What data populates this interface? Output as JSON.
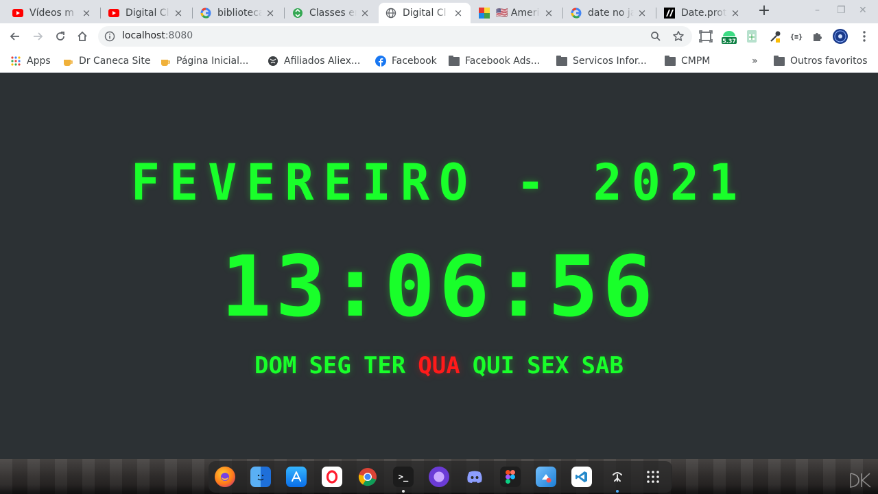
{
  "browser": {
    "tabs": [
      {
        "title": "Vídeos m",
        "favicon": "youtube-icon"
      },
      {
        "title": "Digital Cl",
        "favicon": "youtube-icon"
      },
      {
        "title": "biblioteca",
        "favicon": "google-icon"
      },
      {
        "title": "Classes er",
        "favicon": "recycle-icon"
      },
      {
        "title": "Digital Cl",
        "favicon": "globe-icon",
        "active": true
      },
      {
        "title": "🇺🇸 Americ",
        "favicon": "multicolor-icon"
      },
      {
        "title": "date no ja",
        "favicon": "google-icon"
      },
      {
        "title": "Date.prot",
        "favicon": "mdn-icon"
      }
    ],
    "new_tab": "+",
    "window_controls": {
      "minimize": "–",
      "maximize": "❐",
      "close": "✕"
    },
    "address": {
      "host": "localhost",
      "port": ":8080"
    },
    "extension_badge": "5.37",
    "bookmarks": [
      {
        "label": "Apps",
        "icon": "apps-grid-icon"
      },
      {
        "label": "Dr Caneca Site",
        "icon": "caneca-icon"
      },
      {
        "label": "Página Inicial...",
        "icon": "caneca-icon"
      },
      {
        "label": "Afiliados Aliex...",
        "icon": "globe-icon"
      },
      {
        "label": "Facebook",
        "icon": "facebook-icon"
      },
      {
        "label": "Facebook Ads...",
        "icon": "folder-icon"
      },
      {
        "label": "Servicos Infor...",
        "icon": "folder-icon"
      },
      {
        "label": "CMPM",
        "icon": "folder-icon"
      },
      {
        "label": "»",
        "icon": "overflow-chevron-icon"
      },
      {
        "label": "Outros favoritos",
        "icon": "folder-icon"
      }
    ]
  },
  "clock": {
    "month_year": "FEVEREIRO - 2021",
    "time": "13:06:56",
    "weekdays": [
      "DOM",
      "SEG",
      "TER",
      "QUA",
      "QUI",
      "SEX",
      "SAB"
    ],
    "current_weekday": "QUA",
    "colors": {
      "lcd_green": "#19ff2a",
      "highlight_red": "#ff1a1a",
      "background": "#2c3134"
    }
  },
  "dock": {
    "apps": [
      "firefox-icon",
      "finder-icon",
      "app-store-icon",
      "opera-icon",
      "chrome-icon",
      "terminal-icon",
      "browser-purple-icon",
      "discord-icon",
      "figma-icon",
      "screenshot-tool-icon",
      "vscode-icon",
      "launcher-icon",
      "app-grid-icon"
    ],
    "terminal_glyph": ">_"
  }
}
